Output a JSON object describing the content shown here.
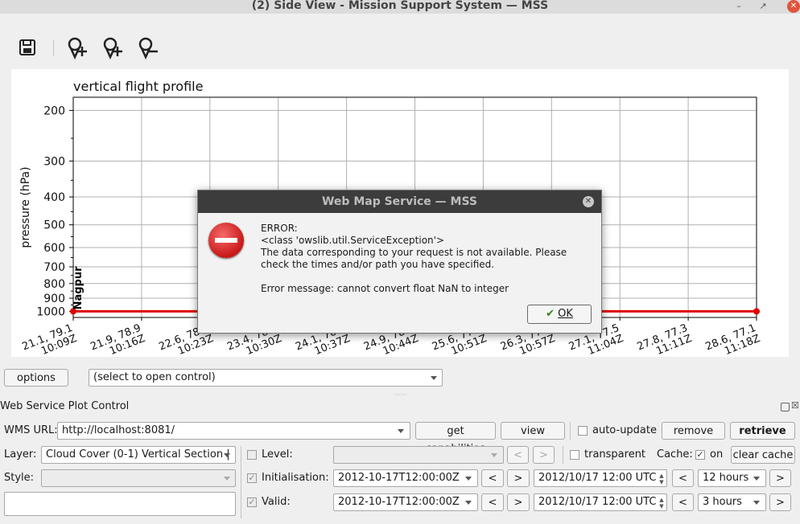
{
  "window": {
    "title": "(2) Side View - Mission Support System — MSS"
  },
  "toolbar": {
    "icons": [
      "save-icon",
      "add-waypoint-icon",
      "move-waypoint-icon",
      "delete-waypoint-icon"
    ]
  },
  "chart_data": {
    "type": "line",
    "title": "vertical flight profile",
    "ylabel": "pressure (hPa)",
    "y_scale": "log",
    "ylim": [
      1050,
      180
    ],
    "y_ticks": [
      "200",
      "300",
      "400",
      "500",
      "600",
      "700",
      "800",
      "900",
      "1000"
    ],
    "x_ticks": [
      [
        "21.1, 79.1",
        "10:09Z"
      ],
      [
        "21.9, 78.9",
        "10:16Z"
      ],
      [
        "22.6, 78.7",
        "10:23Z"
      ],
      [
        "23.4, 78.5",
        "10:30Z"
      ],
      [
        "24.1, 78.3",
        "10:37Z"
      ],
      [
        "24.9, 78.1",
        "10:44Z"
      ],
      [
        "25.6, 77.9",
        "10:51Z"
      ],
      [
        "26.3, 77.7",
        "10:57Z"
      ],
      [
        "27.1, 77.5",
        "11:04Z"
      ],
      [
        "27.8, 77.3",
        "11:11Z"
      ],
      [
        "28.6, 77.1",
        "11:18Z"
      ]
    ],
    "grid": true,
    "series": [
      {
        "values": [
          1000,
          1000
        ],
        "color": "#e00000"
      }
    ],
    "annotations": [
      "Nagpur"
    ]
  },
  "plot_selector": {
    "options_label": "options",
    "select_value": "(select to open control)"
  },
  "wms": {
    "panel_title": "Web Service Plot Control",
    "url_label": "WMS URL:",
    "url_value": "http://localhost:8081/",
    "get_capabilities": "get capabilities",
    "view": "view",
    "auto_update": "auto-update",
    "remove": "remove",
    "retrieve": "retrieve",
    "layer_label": "Layer:",
    "layer_value": "Cloud Cover (0-1) Vertical Section |",
    "level_label": "Level:",
    "transparent_label": "transparent",
    "cache_label": "Cache:",
    "cache_on": "on",
    "clear_cache": "clear cache",
    "style_label": "Style:",
    "init_label": "Initialisation:",
    "init_value": "2012-10-17T12:00:00Z",
    "init_datetime": "2012/10/17 12:00 UTC",
    "init_step": "12 hours",
    "valid_label": "Valid:",
    "valid_value": "2012-10-17T12:00:00Z",
    "valid_datetime": "2012/10/17 12:00 UTC",
    "valid_step": "3 hours",
    "prev": "<",
    "next": ">"
  },
  "dialog": {
    "title": "Web Map Service — MSS",
    "message": "ERROR:\n<class 'owslib.util.ServiceException'>\nThe data corresponding to your request is not available. Please check the times and/or path you have specified.\n\nError message: cannot convert float NaN to integer",
    "ok_label": "OK"
  }
}
